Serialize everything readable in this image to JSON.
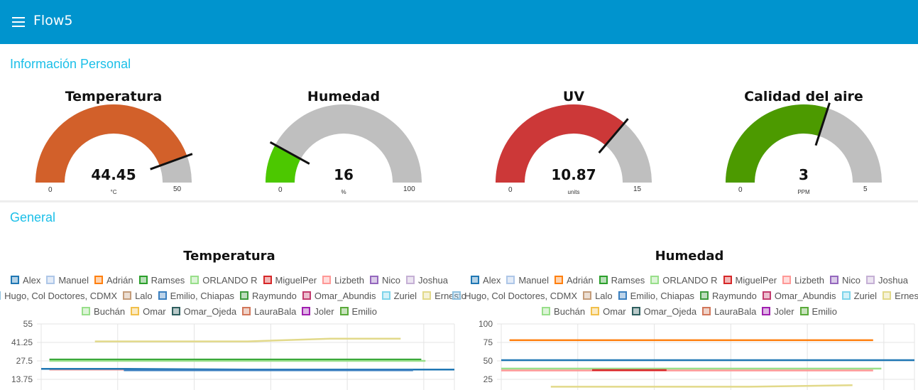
{
  "app": {
    "title": "Flow5"
  },
  "personal": {
    "title": "Información Personal",
    "gauges": [
      {
        "title": "Temperatura",
        "value": "44.45",
        "numeric": 44.45,
        "min": "0",
        "max": "50",
        "minv": 0,
        "maxv": 50,
        "unit": "°C",
        "color": "#d2602a"
      },
      {
        "title": "Humedad",
        "value": "16",
        "numeric": 16,
        "min": "0",
        "max": "100",
        "minv": 0,
        "maxv": 100,
        "unit": "%",
        "color": "#4cc800"
      },
      {
        "title": "UV",
        "value": "10.87",
        "numeric": 10.87,
        "min": "0",
        "max": "15",
        "minv": 0,
        "maxv": 15,
        "unit": "units",
        "color": "#cc3838"
      },
      {
        "title": "Calidad del aire",
        "value": "3",
        "numeric": 3,
        "min": "0",
        "max": "5",
        "minv": 0,
        "maxv": 5,
        "unit": "PPM",
        "color": "#4c9a00"
      }
    ]
  },
  "general": {
    "title": "General",
    "legend_rows": [
      [
        "Alex",
        "Manuel",
        "Adrián",
        "Ramses",
        "ORLANDO R",
        "MiguelPer",
        "Lizbeth",
        "Nico",
        "Joshua"
      ],
      [
        "Hugo, Col Doctores, CDMX",
        "Lalo",
        "Emilio, Chiapas",
        "Raymundo",
        "Omar_Abundis",
        "Zuriel",
        "Ernesto"
      ],
      [
        "Buchán",
        "Omar",
        "Omar_Ojeda",
        "LauraBala",
        "Joler",
        "Emilio"
      ]
    ],
    "legend_colors": {
      "Alex": "#1f77b4",
      "Manuel": "#aec7e8",
      "Adrián": "#ff7f0e",
      "Ramses": "#2ca02c",
      "ORLANDO R": "#98df8a",
      "MiguelPer": "#d62728",
      "Lizbeth": "#ff9896",
      "Nico": "#9467bd",
      "Joshua": "#c5b0d5",
      "Hugo, Col Doctores, CDMX": "#8fc1e0",
      "Lalo": "#c49c7a",
      "Emilio, Chiapas": "#3a7fbf",
      "Raymundo": "#3d9a3d",
      "Omar_Abundis": "#c23b6d",
      "Zuriel": "#7fd4ea",
      "Ernesto": "#e2d98a",
      "Buchán": "#98df8a",
      "Omar": "#f2c04b",
      "Omar_Ojeda": "#2f5f5f",
      "LauraBala": "#d2775a",
      "Joler": "#a020b0",
      "Emilio": "#5aaa3a"
    },
    "charts": [
      {
        "title": "Temperatura",
        "chart_data": {
          "type": "line",
          "yticks": [
            "55",
            "41.25",
            "27.5",
            "13.75"
          ],
          "ytick_values": [
            55,
            41.25,
            27.5,
            13.75
          ],
          "ylim": [
            0,
            55
          ],
          "xlim": [
            0,
            100
          ],
          "series": [
            {
              "name": "Ernesto",
              "x": [
                13,
                50,
                70,
                87
              ],
              "y": [
                42,
                42,
                44,
                44
              ]
            },
            {
              "name": "Ramses",
              "x": [
                2,
                92
              ],
              "y": [
                28.5,
                28.5
              ]
            },
            {
              "name": "Buchán",
              "x": [
                2,
                93
              ],
              "y": [
                27.5,
                27.5
              ]
            },
            {
              "name": "Lizbeth",
              "x": [
                2,
                92
              ],
              "y": [
                21,
                21
              ]
            },
            {
              "name": "Alex",
              "x": [
                0,
                20,
                50,
                100
              ],
              "y": [
                21.5,
                21.5,
                21,
                21
              ]
            },
            {
              "name": "Emilio, Chiapas",
              "x": [
                20,
                50,
                90
              ],
              "y": [
                20.5,
                20.5,
                20.5
              ]
            }
          ]
        }
      },
      {
        "title": "Humedad",
        "chart_data": {
          "type": "line",
          "yticks": [
            "100",
            "75",
            "50",
            "25"
          ],
          "ytick_values": [
            100,
            75,
            50,
            25
          ],
          "ylim": [
            0,
            100
          ],
          "xlim": [
            0,
            100
          ],
          "series": [
            {
              "name": "Adrián",
              "x": [
                2,
                90
              ],
              "y": [
                78,
                78
              ]
            },
            {
              "name": "Alex",
              "x": [
                0,
                100
              ],
              "y": [
                51,
                51
              ]
            },
            {
              "name": "ORLANDO R",
              "x": [
                0,
                92
              ],
              "y": [
                39.5,
                39.5
              ]
            },
            {
              "name": "Lizbeth",
              "x": [
                0,
                90
              ],
              "y": [
                37,
                37
              ]
            },
            {
              "name": "MiguelPer",
              "x": [
                22,
                40
              ],
              "y": [
                37.5,
                37.5
              ]
            },
            {
              "name": "Ernesto",
              "x": [
                12,
                60,
                85
              ],
              "y": [
                15,
                15,
                17
              ]
            }
          ]
        }
      }
    ]
  }
}
